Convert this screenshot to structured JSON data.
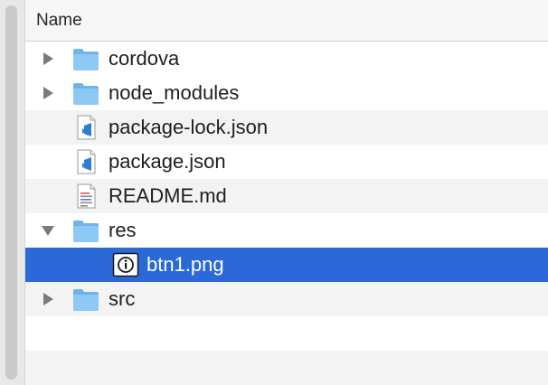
{
  "header": {
    "name_label": "Name"
  },
  "rows": [
    {
      "label": "cordova",
      "icon": "folder-icon",
      "disclosure": "collapsed"
    },
    {
      "label": "node_modules",
      "icon": "folder-icon",
      "disclosure": "collapsed"
    },
    {
      "label": "package-lock.json",
      "icon": "vscode-file-icon",
      "disclosure": "none"
    },
    {
      "label": "package.json",
      "icon": "vscode-file-icon",
      "disclosure": "none"
    },
    {
      "label": "README.md",
      "icon": "text-file-icon",
      "disclosure": "none"
    },
    {
      "label": "res",
      "icon": "folder-icon",
      "disclosure": "expanded"
    },
    {
      "label": "btn1.png",
      "icon": "info-file-icon",
      "disclosure": "none",
      "selected": true
    },
    {
      "label": "src",
      "icon": "folder-icon",
      "disclosure": "collapsed"
    }
  ],
  "colors": {
    "selection": "#2b6ad6",
    "folder": "#7dbcf0",
    "stripe": "#f3f3f3"
  }
}
